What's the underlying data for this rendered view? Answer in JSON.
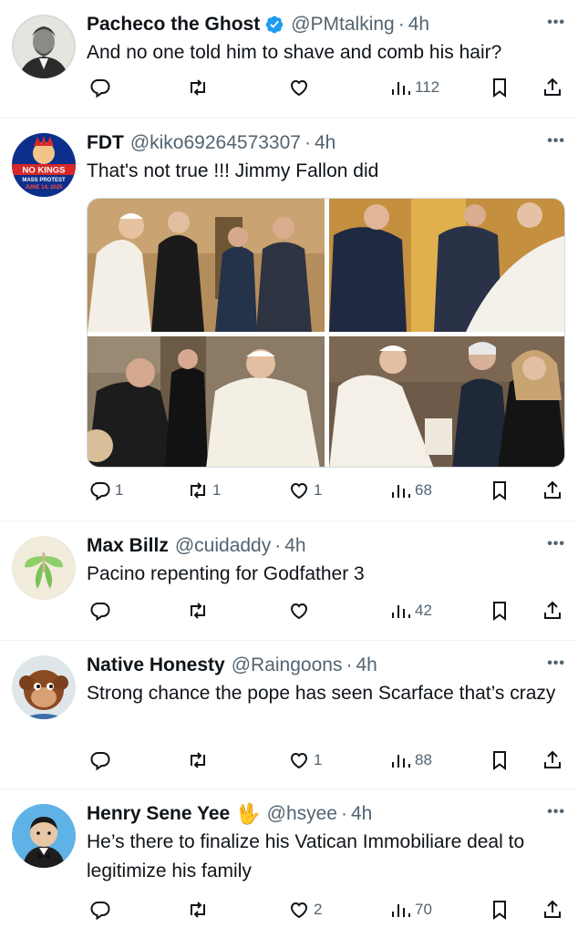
{
  "tweets": [
    {
      "name": "Pacheco the Ghost",
      "verified": true,
      "handle": "@PMtalking",
      "time": "4h",
      "text": "And no one told him to shave and comb his hair?",
      "replies": "",
      "retweets": "",
      "likes": "",
      "views": "112"
    },
    {
      "name": "FDT",
      "handle": "@kiko69264573307",
      "time": "4h",
      "text": "That's not true !!! Jimmy Fallon did",
      "replies": "1",
      "retweets": "1",
      "likes": "1",
      "views": "68",
      "avatar_badge": {
        "line1": "NO KINGS",
        "line2": "MASS PROTEST",
        "line3": "JUNE 14, 2025"
      }
    },
    {
      "name": "Max Billz",
      "handle": "@cuidaddy",
      "time": "4h",
      "text": "Pacino repenting for Godfather 3",
      "replies": "",
      "retweets": "",
      "likes": "",
      "views": "42"
    },
    {
      "name": "Native Honesty",
      "handle": "@Raingoons",
      "time": "4h",
      "text": "Strong chance the pope has seen Scarface that’s crazy",
      "replies": "",
      "retweets": "",
      "likes": "1",
      "views": "88"
    },
    {
      "name": "Henry Sene Yee",
      "emoji": "🖖",
      "handle": "@hsyee",
      "time": "4h",
      "text": "He’s there to finalize his Vatican Immobiliare deal to legitimize his family",
      "replies": "",
      "retweets": "",
      "likes": "2",
      "views": "70"
    }
  ],
  "separators": {
    "dot": "·",
    "more": "•••"
  },
  "colors": {
    "text_primary": "#0f1419",
    "text_secondary": "#536471",
    "verified_blue": "#1d9bf0",
    "divider": "#eff3f4"
  }
}
